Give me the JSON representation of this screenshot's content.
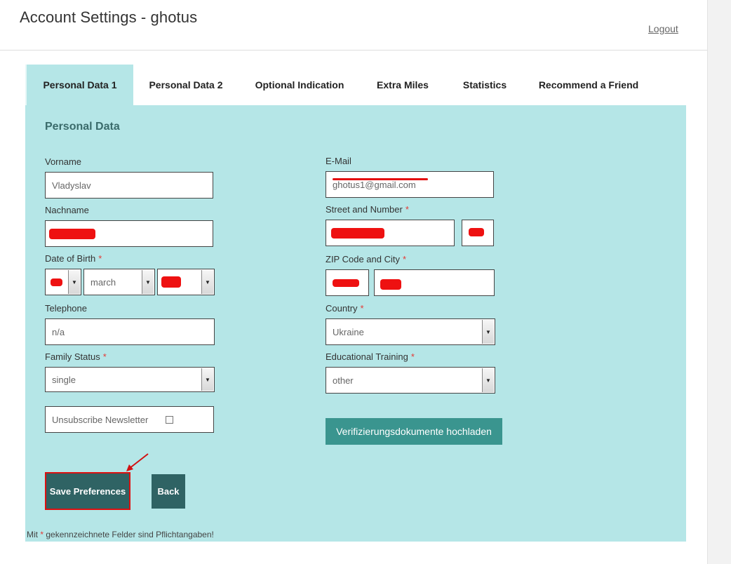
{
  "header": {
    "title": "Account Settings - ghotus",
    "logout_label": "Logout"
  },
  "tabs": [
    {
      "label": "Personal Data 1",
      "active": true
    },
    {
      "label": "Personal Data 2",
      "active": false
    },
    {
      "label": "Optional Indication",
      "active": false
    },
    {
      "label": "Extra Miles",
      "active": false
    },
    {
      "label": "Statistics",
      "active": false
    },
    {
      "label": "Recommend a Friend",
      "active": false
    }
  ],
  "section_title": "Personal Data",
  "form": {
    "vorname": {
      "label": "Vorname",
      "value": "Vladyslav"
    },
    "nachname": {
      "label": "Nachname",
      "value": ""
    },
    "dob": {
      "label": "Date of Birth",
      "required_mark": "*",
      "day": "",
      "month": "march",
      "year": ""
    },
    "telephone": {
      "label": "Telephone",
      "value": "n/a"
    },
    "family_status": {
      "label": "Family Status",
      "required_mark": "*",
      "value": "single"
    },
    "newsletter": {
      "label": "Unsubscribe Newsletter",
      "checked": false
    },
    "email": {
      "label": "E-Mail",
      "value": "ghotus1@gmail.com"
    },
    "street": {
      "label": "Street and Number",
      "required_mark": "*",
      "value": "",
      "number": ""
    },
    "zip_city": {
      "label": "ZIP Code and City",
      "required_mark": "*",
      "zip": "",
      "city": ""
    },
    "country": {
      "label": "Country",
      "required_mark": "*",
      "value": "Ukraine"
    },
    "education": {
      "label": "Educational Training",
      "required_mark": "*",
      "value": "other"
    }
  },
  "buttons": {
    "upload_docs": "Verifizierungsdokumente hochladen",
    "save": "Save Preferences",
    "back": "Back"
  },
  "footnote": {
    "prefix": "Mit",
    "mark": "*",
    "suffix": "gekennzeichnete Felder sind Pflichtangaben!"
  },
  "colors": {
    "panel_bg": "#b5e6e7",
    "teal_button": "#3a958f",
    "dark_button": "#2f6364",
    "redaction": "#ee1111",
    "annotation": "#d11111"
  }
}
